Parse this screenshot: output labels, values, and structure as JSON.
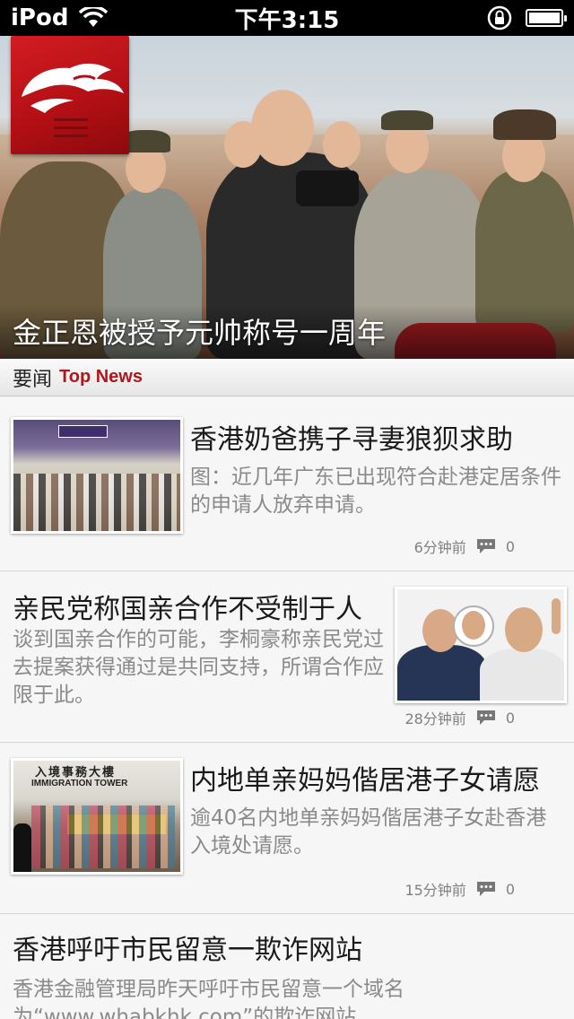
{
  "status_bar": {
    "carrier": "iPod",
    "time": "下午3:15"
  },
  "hero": {
    "caption": "金正恩被授予元帅称号一周年"
  },
  "section": {
    "title_cn": "要闻",
    "title_en": "Top News"
  },
  "news": [
    {
      "title": "香港奶爸携子寻妻狼狈求助",
      "summary": "图：近几年广东已出现符合赴港定居条件的申请人放弃申请。",
      "time": "6分钟前",
      "comments": "0"
    },
    {
      "title": "亲民党称国亲合作不受制于人",
      "summary": "谈到国亲合作的可能，李桐豪称亲民党过去提案获得通过是共同支持，所谓合作应限于此。",
      "time": "28分钟前",
      "comments": "0"
    },
    {
      "title": "内地单亲妈妈偕居港子女请愿",
      "summary": "逾40名内地单亲妈妈偕居港子女赴香港入境处请愿。",
      "time": "15分钟前",
      "comments": "0"
    },
    {
      "title": "香港呼吁市民留意一欺诈网站",
      "summary": "香港金融管理局昨天呼吁市民留意一个域名为“www.whabkhk.com”的欺诈网站"
    }
  ],
  "thumb_texts": {
    "immigration_cn": "入境事務大樓",
    "immigration_en": "IMMIGRATION TOWER"
  },
  "colors": {
    "brand_red": "#b0161c",
    "text_dark": "#1a1a1a",
    "text_gray": "#8a8a8a"
  }
}
